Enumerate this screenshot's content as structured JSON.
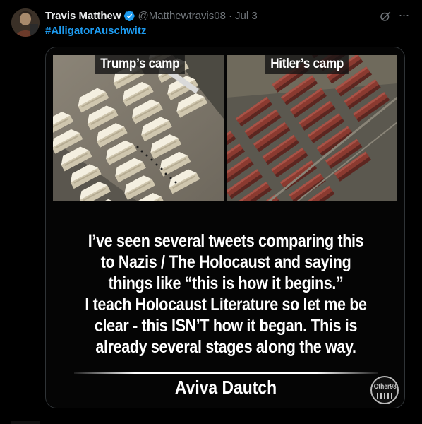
{
  "tweet": {
    "display_name": "Travis Matthew",
    "handle": "@Matthewtravis08",
    "separator": "·",
    "date": "Jul 3",
    "hashtag": "#AlligatorAuschwitz",
    "more_glyph": "···",
    "icons": {
      "verified": "verified-badge-icon",
      "grok": "grok-icon",
      "more": "more-options-icon"
    },
    "colors": {
      "background": "#000000",
      "primary_text": "#e7e9ea",
      "secondary_text": "#71767b",
      "link": "#1d9bf0",
      "verified": "#1d9bf0",
      "border": "#2f3336"
    }
  },
  "media": {
    "left_label": "Trump’s camp",
    "right_label": "Hitler’s camp",
    "quote_lines": [
      "I’ve seen several tweets comparing this",
      "to Nazis / The Holocaust and saying",
      "things like “this is how it begins.”",
      "I teach Holocaust Literature so let me be",
      "clear - this ISN’T how it began. This is",
      "already several stages along the way."
    ],
    "author": "Aviva Dautch",
    "watermark": "Other98"
  }
}
